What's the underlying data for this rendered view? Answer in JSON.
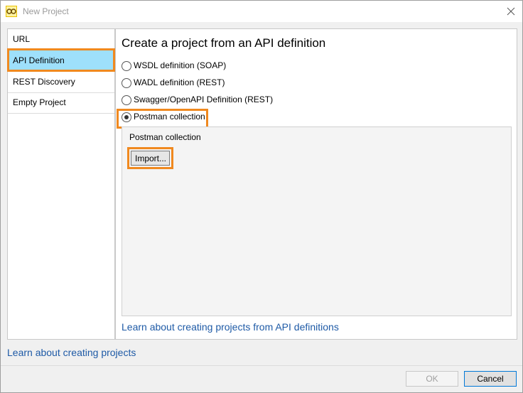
{
  "window": {
    "title": "New Project"
  },
  "nav": {
    "items": [
      {
        "label": "URL",
        "selected": false
      },
      {
        "label": "API Definition",
        "selected": true
      },
      {
        "label": "REST Discovery",
        "selected": false
      },
      {
        "label": "Empty Project",
        "selected": false
      }
    ]
  },
  "main": {
    "heading": "Create a project from an API definition",
    "options": [
      {
        "label": "WSDL definition (SOAP)",
        "checked": false
      },
      {
        "label": "WADL definition (REST)",
        "checked": false
      },
      {
        "label": "Swagger/OpenAPI Definition (REST)",
        "checked": false
      },
      {
        "label": "Postman collection",
        "checked": true
      }
    ],
    "group": {
      "title": "Postman collection",
      "import_label": "Import..."
    },
    "learn_link": "Learn about creating projects from API definitions"
  },
  "bottom_link": "Learn about creating projects",
  "footer": {
    "ok_label": "OK",
    "cancel_label": "Cancel"
  },
  "colors": {
    "selection": "#9ee0fb",
    "highlight": "#f0891f",
    "link": "#1e5aa6"
  }
}
